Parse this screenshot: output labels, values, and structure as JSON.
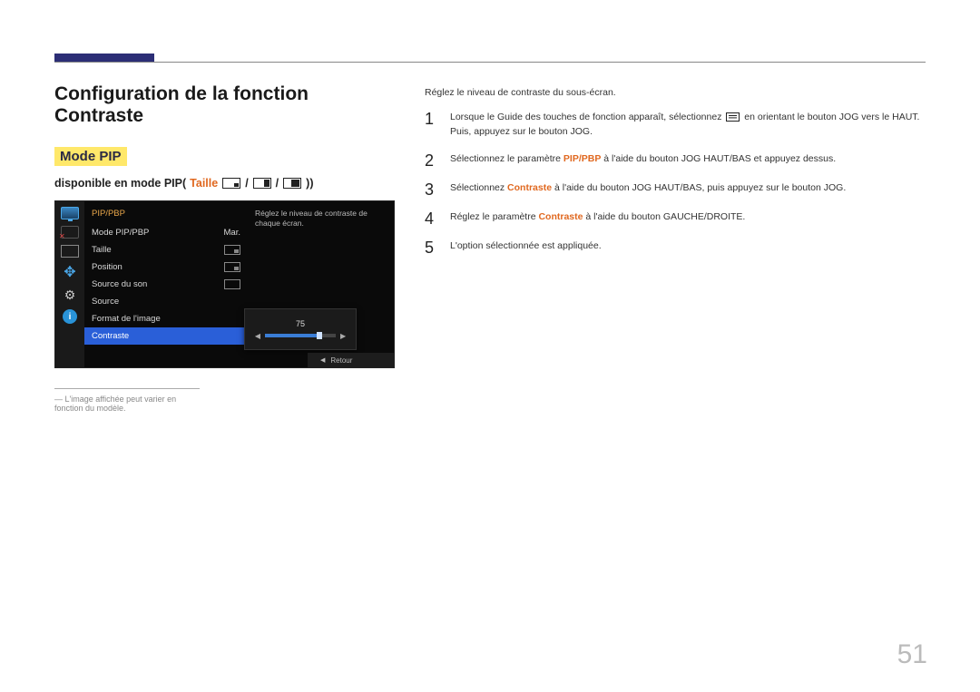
{
  "page_number": "51",
  "title": "Configuration de la fonction Contraste",
  "mode_label": "Mode PIP",
  "avail": {
    "prefix": "disponible en mode PIP(",
    "taille": "Taille",
    "sep": " / ",
    "suffix": "))"
  },
  "osd": {
    "category": "PIP/PBP",
    "items": [
      {
        "label": "Mode PIP/PBP",
        "value": "Mar."
      },
      {
        "label": "Taille"
      },
      {
        "label": "Position"
      },
      {
        "label": "Source du son"
      },
      {
        "label": "Source"
      },
      {
        "label": "Format de l'image"
      },
      {
        "label": "Contraste"
      }
    ],
    "help": "Réglez le niveau de contraste de chaque écran.",
    "slider_value": "75",
    "return_label": "Retour"
  },
  "footnote": "― L'image affichée peut varier en fonction du modèle.",
  "intro": "Réglez le niveau de contraste du sous-écran.",
  "steps": [
    {
      "n": "1",
      "pre": "Lorsque le Guide des touches de fonction apparaît, sélectionnez ",
      "post": " en orientant le bouton JOG vers le HAUT. Puis, appuyez sur le bouton JOG."
    },
    {
      "n": "2",
      "pre": "Sélectionnez le paramètre ",
      "hl": "PIP/PBP",
      "post": " à l'aide du bouton JOG HAUT/BAS et appuyez dessus."
    },
    {
      "n": "3",
      "pre": "Sélectionnez ",
      "hl": "Contraste",
      "post": " à l'aide du bouton JOG HAUT/BAS, puis appuyez sur le bouton JOG."
    },
    {
      "n": "4",
      "pre": "Réglez le paramètre ",
      "hl": "Contraste",
      "post": " à l'aide du bouton GAUCHE/DROITE."
    },
    {
      "n": "5",
      "pre": "L'option sélectionnée est appliquée."
    }
  ]
}
